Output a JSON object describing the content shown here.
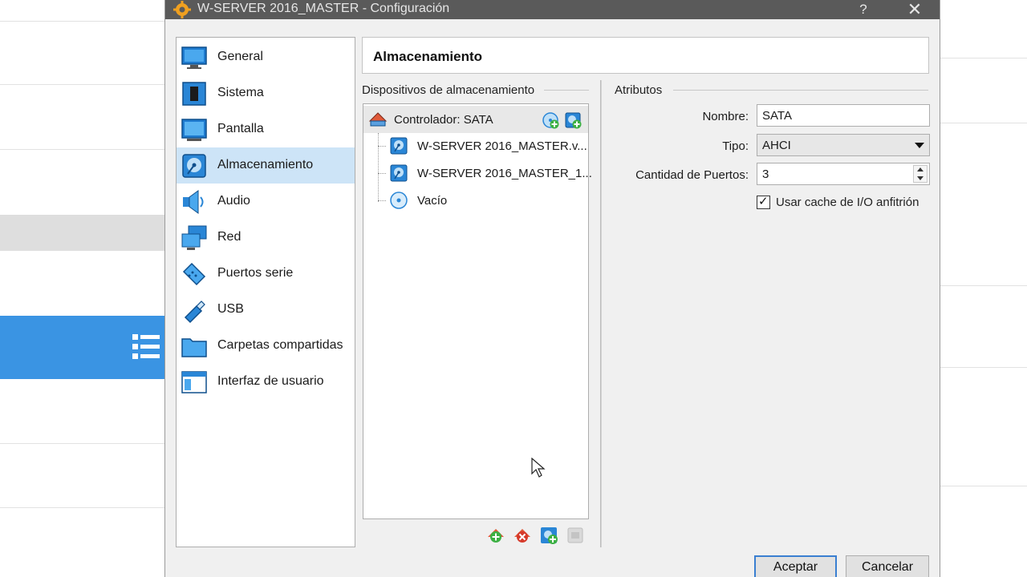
{
  "window": {
    "title": "W-SERVER 2016_MASTER - Configuración",
    "help_label": "?",
    "close_label": "✕"
  },
  "categories": [
    {
      "label": "General",
      "icon": "monitor-icon"
    },
    {
      "label": "Sistema",
      "icon": "chip-icon"
    },
    {
      "label": "Pantalla",
      "icon": "display-icon"
    },
    {
      "label": "Almacenamiento",
      "icon": "hard-disk-icon",
      "selected": true
    },
    {
      "label": "Audio",
      "icon": "speaker-icon"
    },
    {
      "label": "Red",
      "icon": "network-icon"
    },
    {
      "label": "Puertos serie",
      "icon": "serial-port-icon"
    },
    {
      "label": "USB",
      "icon": "usb-icon"
    },
    {
      "label": "Carpetas compartidas",
      "icon": "folder-icon"
    },
    {
      "label": "Interfaz de usuario",
      "icon": "window-icon"
    }
  ],
  "page": {
    "header": "Almacenamiento"
  },
  "storage": {
    "group_title": "Dispositivos de almacenamiento",
    "controller": "Controlador: SATA",
    "devices": [
      {
        "label": "W-SERVER 2016_MASTER.v...",
        "icon": "hard-disk-icon"
      },
      {
        "label": "W-SERVER 2016_MASTER_1...",
        "icon": "hard-disk-icon"
      },
      {
        "label": "Vacío",
        "icon": "optical-disc-icon"
      }
    ]
  },
  "attributes": {
    "group_title": "Atributos",
    "name_label": "Nombre:",
    "name_value": "SATA",
    "type_label": "Tipo:",
    "type_value": "AHCI",
    "ports_label": "Cantidad de Puertos:",
    "ports_value": "3",
    "cache_label": "Usar cache de I/O anfitrión",
    "cache_checked": true,
    "check_mark": "✓"
  },
  "buttons": {
    "ok": "Aceptar",
    "cancel": "Cancelar"
  },
  "colors": {
    "selection": "#cde4f7",
    "accent": "#3a94e3",
    "titlebar": "#5a5a5a"
  }
}
